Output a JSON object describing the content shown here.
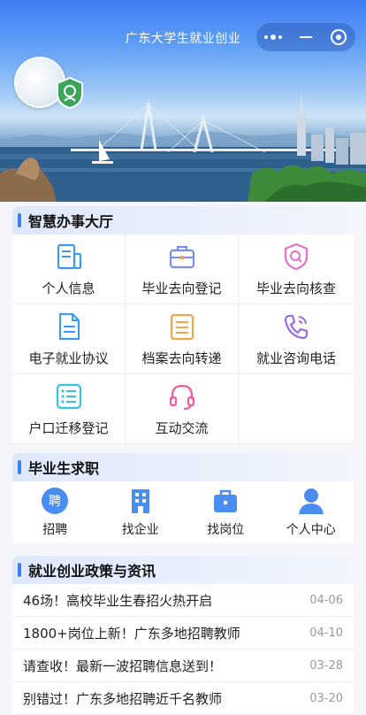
{
  "app": {
    "title": "广东大学生就业创业"
  },
  "banner": {
    "logo_text": ""
  },
  "service_hall": {
    "title": "智慧办事大厅",
    "items": [
      {
        "label": "个人信息",
        "icon": "personal-info-icon",
        "color": "#3b9bf0"
      },
      {
        "label": "毕业去向登记",
        "icon": "briefcase-icon",
        "color": "#7b8fe8"
      },
      {
        "label": "毕业去向核查",
        "icon": "shield-search-icon",
        "color": "#e66fd0"
      },
      {
        "label": "电子就业协议",
        "icon": "document-icon",
        "color": "#3b9bf0"
      },
      {
        "label": "档案去向转递",
        "icon": "archive-icon",
        "color": "#f5a34a"
      },
      {
        "label": "就业咨询电话",
        "icon": "phone-icon",
        "color": "#9a6de0"
      },
      {
        "label": "户口迁移登记",
        "icon": "list-icon",
        "color": "#35c4e0"
      },
      {
        "label": "互动交流",
        "icon": "headset-icon",
        "color": "#ef5aa0"
      }
    ]
  },
  "job_seeking": {
    "title": "毕业生求职",
    "items": [
      {
        "label": "招聘",
        "icon": "recruit-icon",
        "glyph": "聘"
      },
      {
        "label": "找企业",
        "icon": "building-icon"
      },
      {
        "label": "找岗位",
        "icon": "briefcase-icon"
      },
      {
        "label": "个人中心",
        "icon": "user-icon"
      }
    ]
  },
  "news": {
    "title": "就业创业政策与资讯",
    "items": [
      {
        "title": "46场！高校毕业生春招火热开启",
        "date": "04-06"
      },
      {
        "title": "1800+岗位上新！广东多地招聘教师",
        "date": "04-10"
      },
      {
        "title": "请查收！最新一波招聘信息送到！",
        "date": "03-28"
      },
      {
        "title": "别错过！广东多地招聘近千名教师",
        "date": "03-20"
      }
    ]
  }
}
